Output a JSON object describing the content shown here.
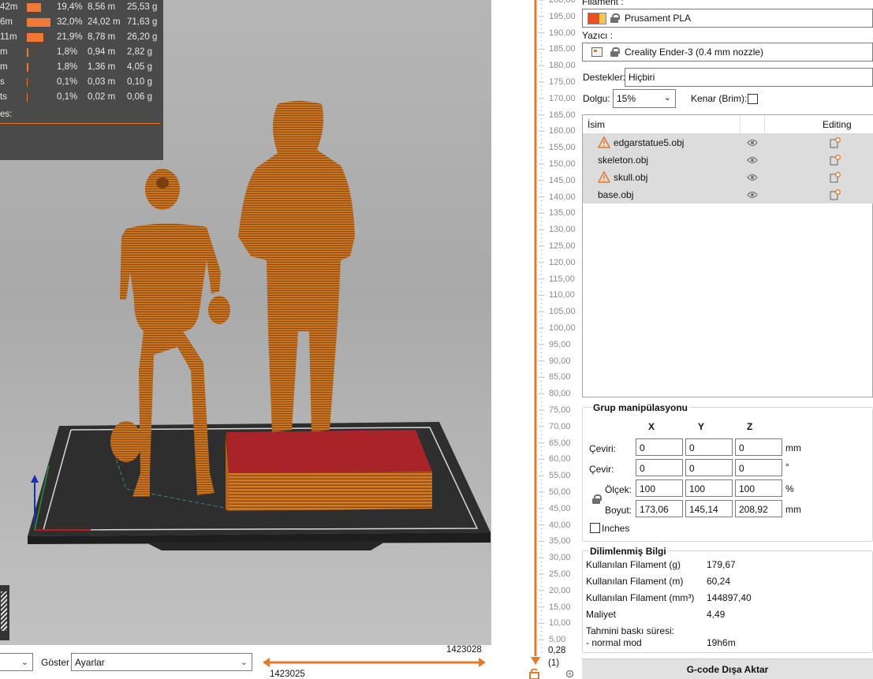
{
  "legend": {
    "rows": [
      {
        "name": "42m",
        "percent": "19,4%",
        "meters": "8,56 m",
        "grams": "25,53 g",
        "share": 0.194
      },
      {
        "name": "6m",
        "percent": "32,0%",
        "meters": "24,02 m",
        "grams": "71,63 g",
        "share": 0.32
      },
      {
        "name": "11m",
        "percent": "21,9%",
        "meters": "8,78 m",
        "grams": "26,20 g",
        "share": 0.219
      },
      {
        "name": "m",
        "percent": "1,8%",
        "meters": "0,94 m",
        "grams": "2,82 g",
        "share": 0.018
      },
      {
        "name": "m",
        "percent": "1,8%",
        "meters": "1,36 m",
        "grams": "4,05 g",
        "share": 0.018
      },
      {
        "name": "s",
        "percent": "0,1%",
        "meters": "0,03 m",
        "grams": "0,10 g",
        "share": 0.001
      },
      {
        "name": "ts",
        "percent": "0,1%",
        "meters": "0,02 m",
        "grams": "0,06 g",
        "share": 0.001
      }
    ],
    "footer": "es:"
  },
  "bottom": {
    "combo_left": "",
    "show_label": "Göster",
    "show_value": "Ayarlar",
    "gcode_top": "1423028",
    "gcode_bottom": "1423025"
  },
  "layer_slider": {
    "ticks": [
      "200,00",
      "195,00",
      "190,00",
      "185,00",
      "180,00",
      "175,00",
      "170,00",
      "165,00",
      "160,00",
      "155,00",
      "150,00",
      "145,00",
      "140,00",
      "135,00",
      "130,00",
      "125,00",
      "120,00",
      "115,00",
      "110,00",
      "105,00",
      "100,00",
      "95,00",
      "90,00",
      "85,00",
      "80,00",
      "75,00",
      "70,00",
      "65,00",
      "60,00",
      "55,00",
      "50,00",
      "45,00",
      "40,00",
      "35,00",
      "30,00",
      "25,00",
      "20,00",
      "15,00",
      "10,00",
      "5,00"
    ],
    "bottom_value": "0,28",
    "bottom_sub": "(1)"
  },
  "panel": {
    "filament_label": "Filament :",
    "filament_value": "Prusament PLA",
    "filament_color": "#e8501e",
    "printer_label": "Yazıcı :",
    "printer_value": "Creality Ender-3 (0.4 mm nozzle)",
    "supports_label": "Destekler:",
    "supports_value": "Hiçbiri",
    "infill_label": "Dolgu:",
    "infill_value": "15%",
    "brim_label": "Kenar (Brim):",
    "list_header_name": "İsim",
    "list_header_editing": "Editing",
    "objects": [
      {
        "name": "edgarstatue5.obj",
        "warning": true
      },
      {
        "name": "skeleton.obj",
        "warning": false
      },
      {
        "name": "skull.obj",
        "warning": true
      },
      {
        "name": "base.obj",
        "warning": false
      }
    ],
    "manip": {
      "title": "Grup manipülasyonu",
      "axes": [
        "X",
        "Y",
        "Z"
      ],
      "position_label": "Çeviri:",
      "position": [
        "0",
        "0",
        "0"
      ],
      "position_unit": "mm",
      "rotation_label": "Çevir:",
      "rotation": [
        "0",
        "0",
        "0"
      ],
      "rotation_unit": "°",
      "scale_label": "Ölçek:",
      "scale": [
        "100",
        "100",
        "100"
      ],
      "scale_unit": "%",
      "size_label": "Boyut:",
      "size": [
        "173,06",
        "145,14",
        "208,92"
      ],
      "size_unit": "mm",
      "inches_label": "Inches"
    },
    "sliced": {
      "title": "Dilimlenmiş Bilgi",
      "rows": [
        {
          "k": "Kullanılan Filament (g)",
          "v": "179,67"
        },
        {
          "k": "Kullanılan Filament (m)",
          "v": "60,24"
        },
        {
          "k": "Kullanılan Filament (mm³)",
          "v": "144897,40"
        },
        {
          "k": "Maliyet",
          "v": "4,49"
        }
      ],
      "time_label": "Tahmini baskı süresi:",
      "mode_label": "- normal mod",
      "mode_value": "19h6m"
    },
    "export_label": "G-code Dışa Aktar"
  }
}
